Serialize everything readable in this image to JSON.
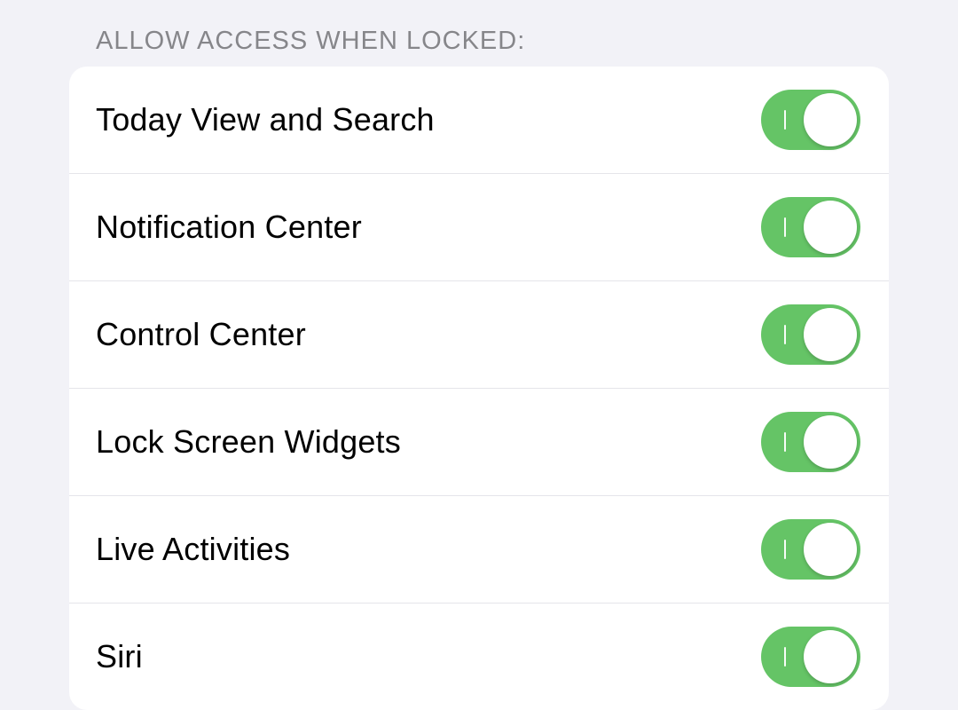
{
  "section": {
    "header": "Allow Access When Locked:"
  },
  "items": [
    {
      "key": "today-view-and-search",
      "label": "Today View and Search",
      "on": true
    },
    {
      "key": "notification-center",
      "label": "Notification Center",
      "on": true
    },
    {
      "key": "control-center",
      "label": "Control Center",
      "on": true
    },
    {
      "key": "lock-screen-widgets",
      "label": "Lock Screen Widgets",
      "on": true
    },
    {
      "key": "live-activities",
      "label": "Live Activities",
      "on": true
    },
    {
      "key": "siri",
      "label": "Siri",
      "on": true
    }
  ],
  "colors": {
    "toggleOn": "#65c466",
    "background": "#f2f2f7",
    "card": "#ffffff",
    "separator": "#e5e5ea",
    "headerText": "#86868a"
  }
}
